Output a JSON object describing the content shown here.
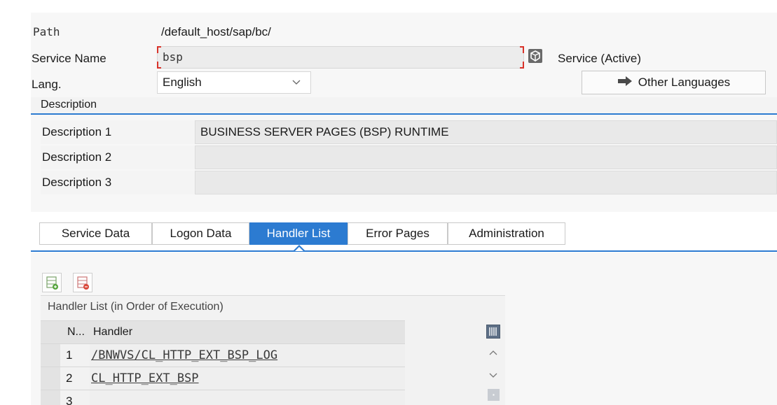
{
  "form": {
    "path_label": "Path",
    "path_value": "/default_host/sap/bc/",
    "service_label": "Service Name",
    "service_value": "bsp",
    "service_status": "Service (Active)",
    "lang_label": "Lang.",
    "lang_value": "English",
    "other_languages_label": "Other Languages"
  },
  "description": {
    "header": "Description",
    "rows": [
      {
        "label": "Description 1",
        "value": "BUSINESS SERVER PAGES (BSP) RUNTIME"
      },
      {
        "label": "Description 2",
        "value": ""
      },
      {
        "label": "Description 3",
        "value": ""
      }
    ]
  },
  "tabs": [
    {
      "label": "Service Data",
      "active": false
    },
    {
      "label": "Logon Data",
      "active": false
    },
    {
      "label": "Handler List",
      "active": true
    },
    {
      "label": "Error Pages",
      "active": false
    },
    {
      "label": "Administration",
      "active": false
    }
  ],
  "handler_list": {
    "title": "Handler List (in Order of Execution)",
    "col_no": "N...",
    "col_handler": "Handler",
    "rows": [
      {
        "no": "1",
        "handler": "/BNWVS/CL_HTTP_EXT_BSP_LOG"
      },
      {
        "no": "2",
        "handler": "CL_HTTP_EXT_BSP"
      },
      {
        "no": "3",
        "handler": ""
      }
    ]
  },
  "icons": {
    "service_info": "service-info-icon",
    "insert_row": "insert-row-icon",
    "delete_row": "delete-row-icon",
    "column_config": "column-config-icon",
    "arrow": "arrow-right-icon"
  },
  "colors": {
    "accent": "#2c7bd1",
    "required_marker": "#d9332a"
  }
}
